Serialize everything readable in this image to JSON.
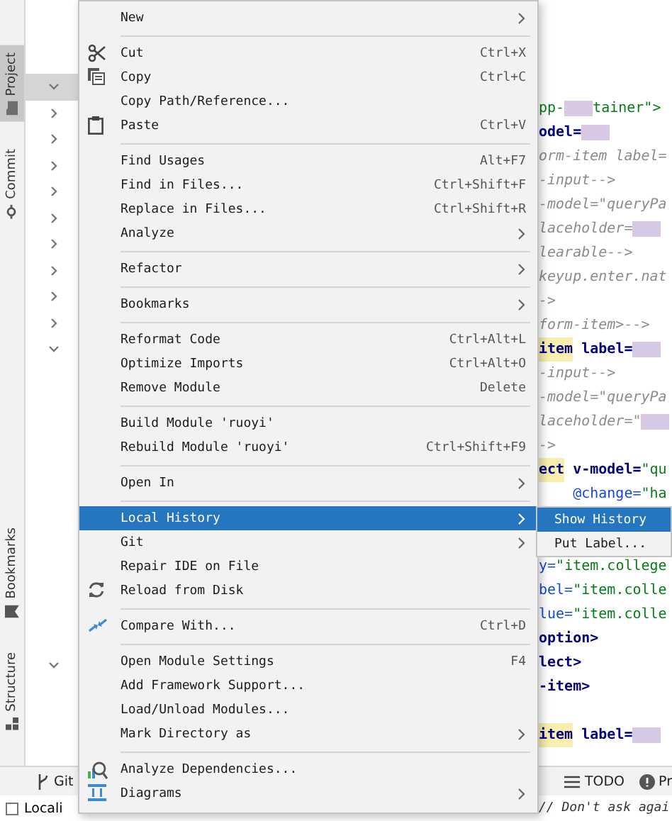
{
  "tool_strip": {
    "top": [
      {
        "label": "Project",
        "selected": true
      },
      {
        "label": "Commit",
        "selected": false
      }
    ],
    "bottom": [
      {
        "label": "Bookmarks"
      },
      {
        "label": "Structure"
      }
    ]
  },
  "project_tree": {
    "rows": [
      {
        "expanded": true,
        "selected": true
      },
      {
        "expanded": false,
        "selected": false
      },
      {
        "expanded": false,
        "selected": false
      },
      {
        "expanded": false,
        "selected": false
      },
      {
        "expanded": false,
        "selected": false
      },
      {
        "expanded": false,
        "selected": false
      },
      {
        "expanded": false,
        "selected": false
      },
      {
        "expanded": false,
        "selected": false
      },
      {
        "expanded": false,
        "selected": false
      },
      {
        "expanded": false,
        "selected": false
      },
      {
        "expanded": true,
        "selected": false
      }
    ],
    "lower_rows": [
      {
        "expanded": true,
        "selected": false
      }
    ]
  },
  "editor": {
    "upper_lines": [
      {
        "segments": [
          {
            "kind": "string",
            "text": "pp-"
          },
          {
            "kind": "blur"
          },
          {
            "kind": "string",
            "text": "tainer\">"
          }
        ]
      },
      {
        "segments": [
          {
            "kind": "tag",
            "text": "odel="
          },
          {
            "kind": "blur"
          }
        ]
      },
      {
        "segments": [
          {
            "kind": "comment",
            "text": "orm-item label="
          }
        ]
      },
      {
        "segments": [
          {
            "kind": "comment",
            "text": "-input-->"
          }
        ]
      },
      {
        "segments": [
          {
            "kind": "comment",
            "text": "-model=\"queryPa"
          }
        ]
      },
      {
        "segments": [
          {
            "kind": "comment",
            "text": "laceholder="
          },
          {
            "kind": "blur"
          }
        ]
      },
      {
        "segments": [
          {
            "kind": "comment",
            "text": "learable-->"
          }
        ]
      },
      {
        "segments": [
          {
            "kind": "comment",
            "text": "keyup.enter.nat"
          }
        ]
      },
      {
        "segments": [
          {
            "kind": "comment",
            "text": "->"
          }
        ]
      },
      {
        "segments": [
          {
            "kind": "comment",
            "text": "form-item>-->"
          }
        ]
      },
      {
        "segments": [
          {
            "kind": "tag",
            "text": "item",
            "highlighted": true
          },
          {
            "kind": "tag",
            "text": " label="
          },
          {
            "kind": "blur"
          }
        ]
      },
      {
        "segments": [
          {
            "kind": "comment",
            "text": "-input-->"
          }
        ]
      },
      {
        "segments": [
          {
            "kind": "comment",
            "text": "-model=\"queryPa"
          }
        ]
      },
      {
        "segments": [
          {
            "kind": "comment",
            "text": "laceholder=\""
          },
          {
            "kind": "blur"
          }
        ]
      },
      {
        "segments": [
          {
            "kind": "comment",
            "text": "->"
          }
        ]
      },
      {
        "segments": [
          {
            "kind": "tag",
            "text": "ect",
            "highlighted": true
          },
          {
            "kind": "tag",
            "text": " v-model="
          },
          {
            "kind": "string",
            "text": "\"qu"
          }
        ]
      },
      {
        "segments": [
          {
            "kind": "attr",
            "text": "    @change="
          },
          {
            "kind": "string",
            "text": "\"ha"
          }
        ]
      }
    ],
    "lower_lines": [
      {
        "segments": [
          {
            "kind": "attr",
            "text": "y="
          },
          {
            "kind": "string",
            "text": "\"item.college"
          }
        ]
      },
      {
        "segments": [
          {
            "kind": "attr",
            "text": "bel="
          },
          {
            "kind": "string",
            "text": "\"item.colle"
          }
        ]
      },
      {
        "segments": [
          {
            "kind": "attr",
            "text": "lue="
          },
          {
            "kind": "string",
            "text": "\"item.colle"
          }
        ]
      },
      {
        "segments": [
          {
            "kind": "tag",
            "text": "option>"
          }
        ]
      },
      {
        "segments": [
          {
            "kind": "tag",
            "text": "lect>"
          }
        ]
      },
      {
        "segments": [
          {
            "kind": "tag",
            "text": "-item>"
          }
        ]
      }
    ],
    "bottom_lines": [
      {
        "segments": [
          {
            "kind": "tag",
            "text": "item",
            "highlighted": true
          },
          {
            "kind": "tag",
            "text": " label="
          },
          {
            "kind": "blur"
          }
        ]
      }
    ]
  },
  "context_menu": {
    "items": [
      {
        "kind": "item",
        "label": "New",
        "submenu": true,
        "selected": false
      },
      {
        "kind": "separator"
      },
      {
        "kind": "item",
        "label": "Cut",
        "shortcut": "Ctrl+X",
        "submenu": false,
        "selected": false
      },
      {
        "kind": "item",
        "label": "Copy",
        "shortcut": "Ctrl+C",
        "submenu": false,
        "selected": false
      },
      {
        "kind": "item",
        "label": "Copy Path/Reference...",
        "submenu": false,
        "selected": false
      },
      {
        "kind": "item",
        "label": "Paste",
        "shortcut": "Ctrl+V",
        "submenu": false,
        "selected": false
      },
      {
        "kind": "separator"
      },
      {
        "kind": "item",
        "label": "Find Usages",
        "shortcut": "Alt+F7",
        "submenu": false,
        "selected": false
      },
      {
        "kind": "item",
        "label": "Find in Files...",
        "shortcut": "Ctrl+Shift+F",
        "submenu": false,
        "selected": false
      },
      {
        "kind": "item",
        "label": "Replace in Files...",
        "shortcut": "Ctrl+Shift+R",
        "submenu": false,
        "selected": false
      },
      {
        "kind": "item",
        "label": "Analyze",
        "submenu": true,
        "selected": false
      },
      {
        "kind": "separator"
      },
      {
        "kind": "item",
        "label": "Refactor",
        "submenu": true,
        "selected": false
      },
      {
        "kind": "separator"
      },
      {
        "kind": "item",
        "label": "Bookmarks",
        "submenu": true,
        "selected": false
      },
      {
        "kind": "separator"
      },
      {
        "kind": "item",
        "label": "Reformat Code",
        "shortcut": "Ctrl+Alt+L",
        "submenu": false,
        "selected": false
      },
      {
        "kind": "item",
        "label": "Optimize Imports",
        "shortcut": "Ctrl+Alt+O",
        "submenu": false,
        "selected": false
      },
      {
        "kind": "item",
        "label": "Remove Module",
        "shortcut": "Delete",
        "submenu": false,
        "selected": false
      },
      {
        "kind": "separator"
      },
      {
        "kind": "item",
        "label": "Build Module 'ruoyi'",
        "submenu": false,
        "selected": false
      },
      {
        "kind": "item",
        "label": "Rebuild Module 'ruoyi'",
        "shortcut": "Ctrl+Shift+F9",
        "submenu": false,
        "selected": false
      },
      {
        "kind": "separator"
      },
      {
        "kind": "item",
        "label": "Open In",
        "submenu": true,
        "selected": false
      },
      {
        "kind": "separator"
      },
      {
        "kind": "item",
        "label": "Local History",
        "submenu": true,
        "selected": true
      },
      {
        "kind": "item",
        "label": "Git",
        "submenu": true,
        "selected": false
      },
      {
        "kind": "item",
        "label": "Repair IDE on File",
        "submenu": false,
        "selected": false
      },
      {
        "kind": "item",
        "label": "Reload from Disk",
        "submenu": false,
        "selected": false
      },
      {
        "kind": "separator"
      },
      {
        "kind": "item",
        "label": "Compare With...",
        "shortcut": "Ctrl+D",
        "submenu": false,
        "selected": false
      },
      {
        "kind": "separator"
      },
      {
        "kind": "item",
        "label": "Open Module Settings",
        "shortcut": "F4",
        "submenu": false,
        "selected": false
      },
      {
        "kind": "item",
        "label": "Add Framework Support...",
        "submenu": false,
        "selected": false
      },
      {
        "kind": "item",
        "label": "Load/Unload Modules...",
        "submenu": false,
        "selected": false
      },
      {
        "kind": "item",
        "label": "Mark Directory as",
        "submenu": true,
        "selected": false
      },
      {
        "kind": "separator"
      },
      {
        "kind": "item",
        "label": "Analyze Dependencies...",
        "submenu": false,
        "selected": false
      },
      {
        "kind": "item",
        "label": "Diagrams",
        "submenu": true,
        "selected": false
      }
    ]
  },
  "submenu": {
    "items": [
      {
        "label": "Show History",
        "selected": true
      },
      {
        "label": "Put Label...",
        "selected": false
      }
    ]
  },
  "tool_window_bar": {
    "left": [
      {
        "label": "Git"
      }
    ],
    "right": [
      {
        "label": "TODO"
      },
      {
        "label": "Pr"
      }
    ]
  },
  "status_bar": {
    "left": {
      "label": "Locali"
    },
    "editor_text": "// Don't ask agai"
  }
}
